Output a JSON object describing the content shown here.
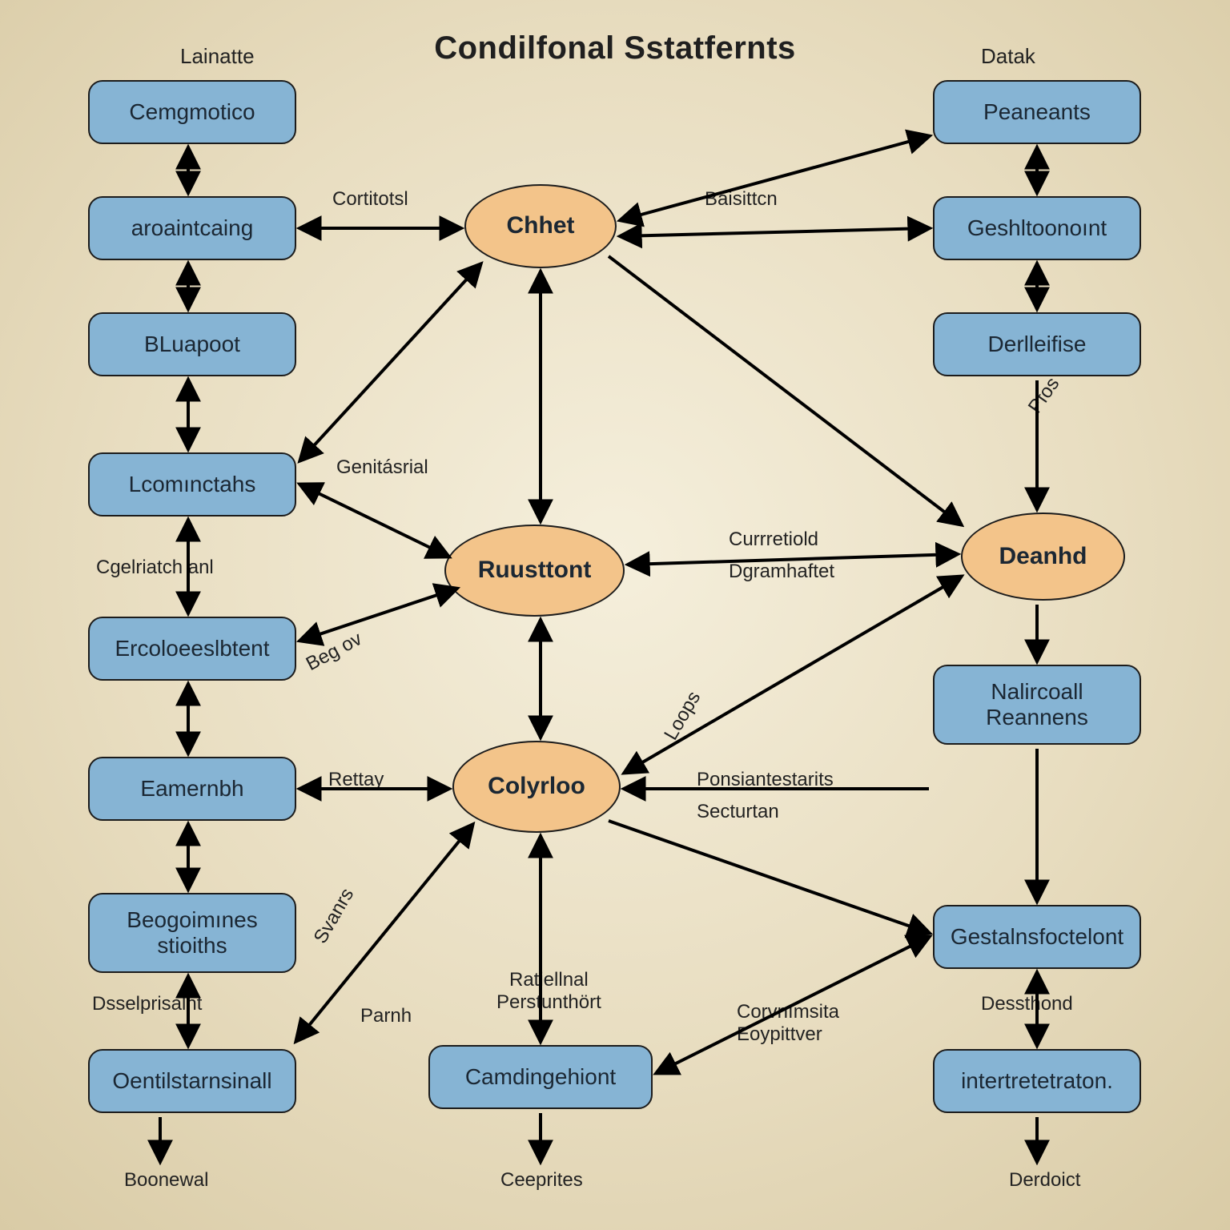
{
  "title": "Condilfonal Sstatfernts",
  "headers": {
    "left": "Lainatte",
    "right": "Datak"
  },
  "left_nodes": {
    "l0": "Cemgmotico",
    "l1": "aroaintcaing",
    "l2": "BLuapoot",
    "l3": "Lcomınctahs",
    "l4": "Ercoloeeslbtent",
    "l5": "Eamernbh",
    "l6": "Beogoimınes\nstioiths",
    "l7": "Oentilstarnsinall"
  },
  "right_nodes": {
    "r0": "Peaneants",
    "r1": "Geshltoonoınt",
    "r2": "Derlleifise",
    "r3": "Nalircoall\nReannens",
    "r4": "Gestalnsfoctelont",
    "r5": "intertretetraton."
  },
  "ellipses": {
    "e_chet": "Chhet",
    "e_rust": "Ruusttont",
    "e_coy": "Colyrloo",
    "e_dean": "Deanhd"
  },
  "bottom": {
    "b_cam": "Camdingehiont"
  },
  "edge_labels": {
    "cortitotsl": "Cortitotsl",
    "barsiton": "Baisittcn",
    "pfos": "Pfos",
    "genitasrial": "Genitásrial",
    "cgeriatchanl": "Cgelriatch anl",
    "curretiold": "Currretiold",
    "dgramhafet": "Dgramhaftet",
    "beg_ov": "Beg ov",
    "rettay": "Rettay",
    "loops": "Loops",
    "ponsan": "Ponsiantestarits",
    "secur": "Secturtan",
    "svans": "Svanrs",
    "parnh": "Parnh",
    "ratt": "Ratiellnal\nPerstunthört",
    "conv": "Corvnımsita\nEoypittver",
    "dessep": "Dsselprisalnt",
    "desst": "Dessthond",
    "boonewal": "Boonewal",
    "ceeprites": "Ceeprites",
    "derdoct": "Derdoict"
  }
}
